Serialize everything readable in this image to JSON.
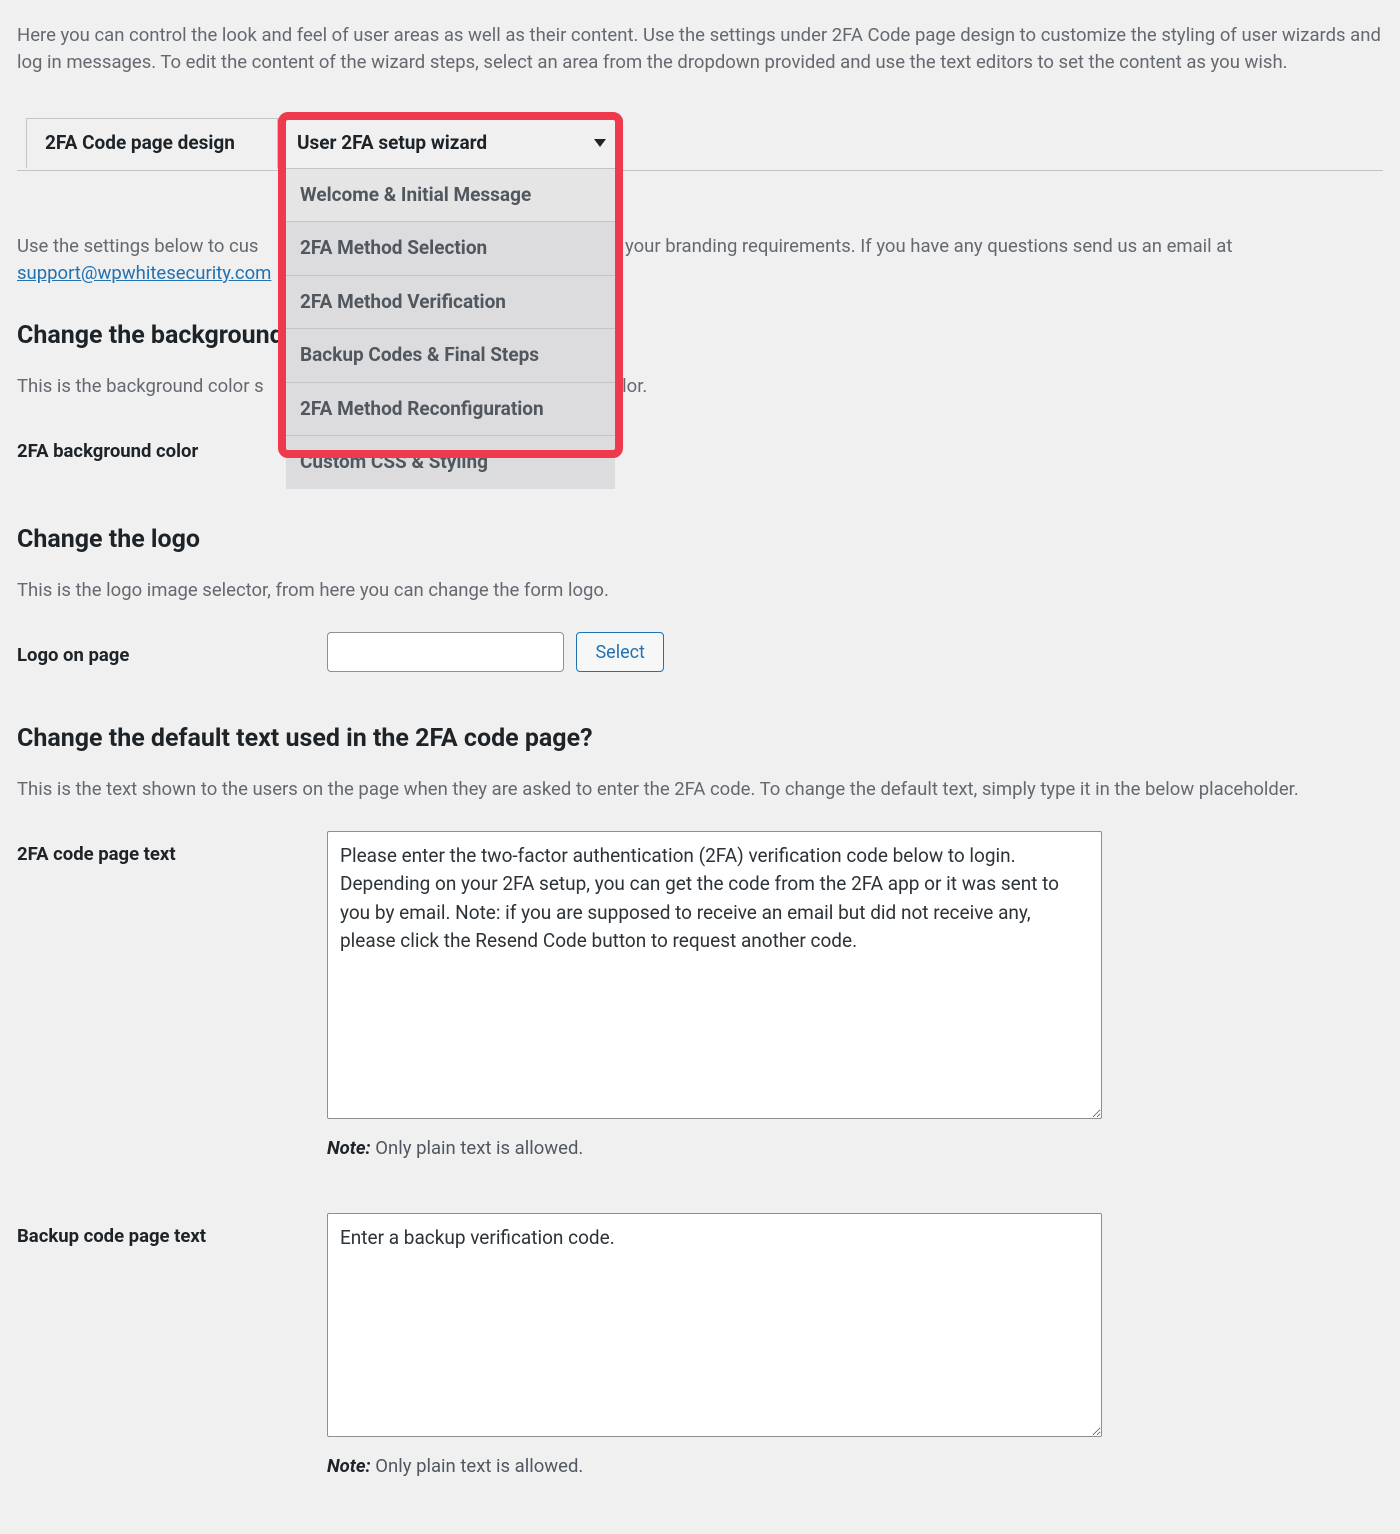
{
  "intro": "Here you can control the look and feel of user areas as well as their content. Use the settings under 2FA Code page design to customize the styling of user wizards and log in messages. To edit the content of the wizard steps, select an area from the dropdown provided and use the text editors to set the content as you wish.",
  "tabs": {
    "design": "2FA Code page design",
    "wizard": "User 2FA setup wizard"
  },
  "dropdown": {
    "opt0": "Welcome & Initial Message",
    "opt1": "2FA Method Selection",
    "opt2": "2FA Method Verification",
    "opt3": "Backup Codes & Final Steps",
    "opt4": "2FA Method Reconfiguration",
    "opt5": "Custom CSS & Styling"
  },
  "para_settings_pre": "Use the settings below to cus",
  "para_settings_post": " it meets your branding requirements. If you have any questions send us an email at ",
  "support_email_text": "support@wpwhitesecurity.com",
  "sec_bg": {
    "h": "Change the background",
    "p": "This is the background color s                                               m background color.",
    "label": "2FA background color"
  },
  "sec_logo": {
    "h": "Change the logo",
    "p": "This is the logo image selector, from here you can change the form logo.",
    "label": "Logo on page",
    "button": "Select"
  },
  "sec_text": {
    "h": "Change the default text used in the 2FA code page?",
    "p": "This is the text shown to the users on the page when they are asked to enter the 2FA code. To change the default text, simply type it in the below placeholder.",
    "label1": "2FA code page text",
    "textarea1": "Please enter the two-factor authentication (2FA) verification code below to login. Depending on your 2FA setup, you can get the code from the 2FA app or it was sent to you by email. Note: if you are supposed to receive an email but did not receive any, please click the Resend Code button to request another code.",
    "note_label": "Note:",
    "note1": " Only plain text is allowed.",
    "label2": "Backup code page text",
    "textarea2": "Enter a backup verification code.",
    "note2": " Only plain text is allowed."
  }
}
